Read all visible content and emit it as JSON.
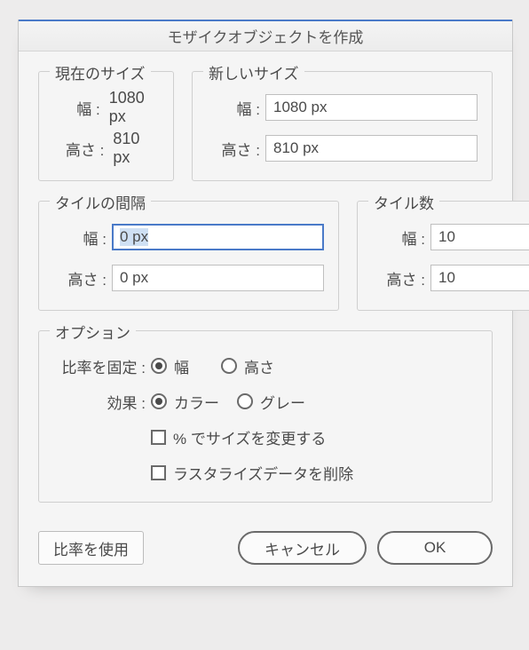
{
  "title": "モザイクオブジェクトを作成",
  "currentSize": {
    "legend": "現在のサイズ",
    "widthLabel": "幅 :",
    "widthValue": "1080 px",
    "heightLabel": "高さ :",
    "heightValue": "810 px"
  },
  "newSize": {
    "legend": "新しいサイズ",
    "widthLabel": "幅 :",
    "widthValue": "1080 px",
    "heightLabel": "高さ :",
    "heightValue": "810 px"
  },
  "tileSpacing": {
    "legend": "タイルの間隔",
    "widthLabel": "幅 :",
    "widthValue": "0 px",
    "heightLabel": "高さ :",
    "heightValue": "0 px"
  },
  "tileCount": {
    "legend": "タイル数",
    "widthLabel": "幅 :",
    "widthValue": "10",
    "heightLabel": "高さ :",
    "heightValue": "10"
  },
  "options": {
    "legend": "オプション",
    "constrainLabel": "比率を固定 :",
    "constrainWidth": "幅",
    "constrainHeight": "高さ",
    "constrainSelected": "width",
    "resultLabel": "効果 :",
    "resultColor": "カラー",
    "resultGray": "グレー",
    "resultSelected": "color",
    "resizePercent": "% でサイズを変更する",
    "deleteRaster": "ラスタライズデータを削除"
  },
  "buttons": {
    "useRatio": "比率を使用",
    "cancel": "キャンセル",
    "ok": "OK"
  }
}
